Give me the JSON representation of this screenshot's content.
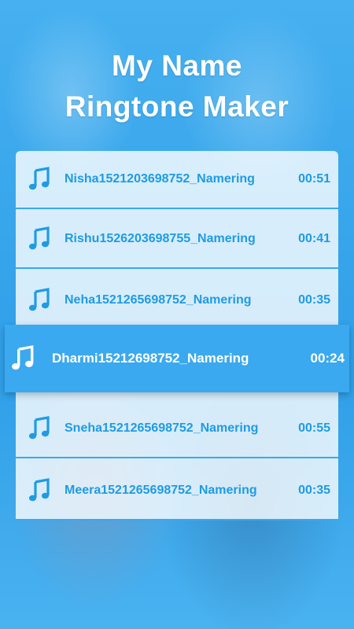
{
  "header": {
    "title_line1": "My Name",
    "title_line2": "Ringtone Maker"
  },
  "ringtones": [
    {
      "name": "Nisha1521203698752_Namering",
      "duration": "00:51",
      "icon": "music-note-icon"
    },
    {
      "name": "Rishu1526203698755_Namering",
      "duration": "00:41",
      "icon": "music-note-icon"
    },
    {
      "name": "Neha1521265698752_Namering",
      "duration": "00:35",
      "icon": "music-note-icon"
    },
    {
      "name": "Dharmi15212698752_Namering",
      "duration": "00:24",
      "icon": "music-note-icon",
      "selected": true
    },
    {
      "name": "Sneha1521265698752_Namering",
      "duration": "00:55",
      "icon": "music-note-icon"
    },
    {
      "name": "Meera1521265698752_Namering",
      "duration": "00:35",
      "icon": "music-note-icon"
    }
  ],
  "colors": {
    "accent": "#1f9be4",
    "selected_background": "#3aa9ef",
    "background": "#3ba9ee"
  }
}
